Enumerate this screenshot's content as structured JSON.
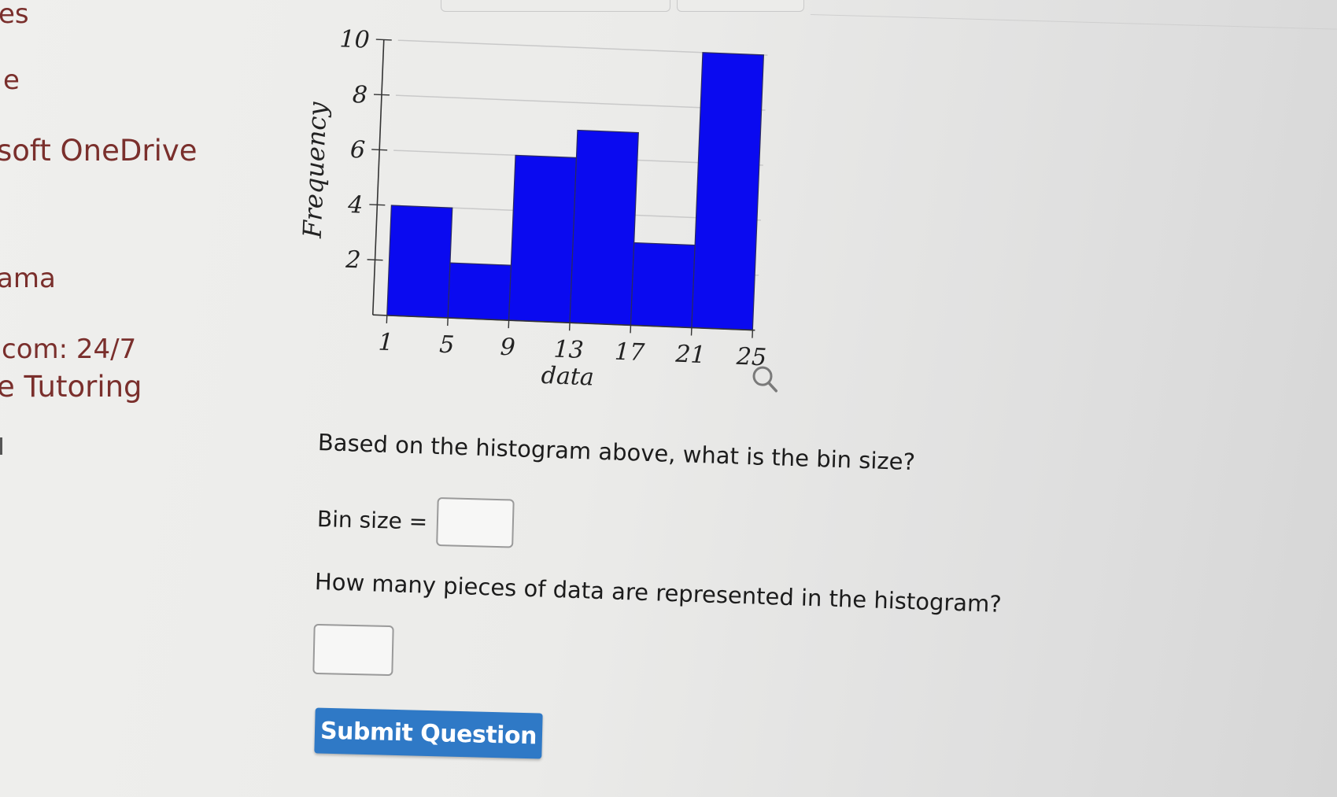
{
  "sidebar": {
    "items": [
      {
        "label": "es"
      },
      {
        "label": "e"
      },
      {
        "label": "soft OneDrive"
      },
      {
        "label": "ama"
      },
      {
        "label": "com: 24/7"
      },
      {
        "label": "e Tutoring"
      }
    ]
  },
  "chart_data": {
    "type": "bar",
    "subtype": "histogram",
    "bin_edges": [
      1,
      5,
      9,
      13,
      17,
      21,
      25
    ],
    "values": [
      4,
      2,
      6,
      7,
      3,
      10
    ],
    "xlabel": "data",
    "ylabel": "Frequency",
    "x_ticks": [
      "1",
      "5",
      "9",
      "13",
      "17",
      "21",
      "25"
    ],
    "y_ticks": [
      "2",
      "4",
      "6",
      "8",
      "10"
    ],
    "ylim": [
      0,
      10
    ],
    "grid": true,
    "bar_color": "#0a0af0"
  },
  "zoom_icon": "magnifier-icon",
  "question1": {
    "text": "Based on the histogram above, what is the bin size?",
    "label": "Bin size =",
    "value": ""
  },
  "question2": {
    "text": "How many pieces of data are represented in the histogram?",
    "value": ""
  },
  "submit": {
    "label": "Submit Question",
    "color": "#2f79c6"
  }
}
